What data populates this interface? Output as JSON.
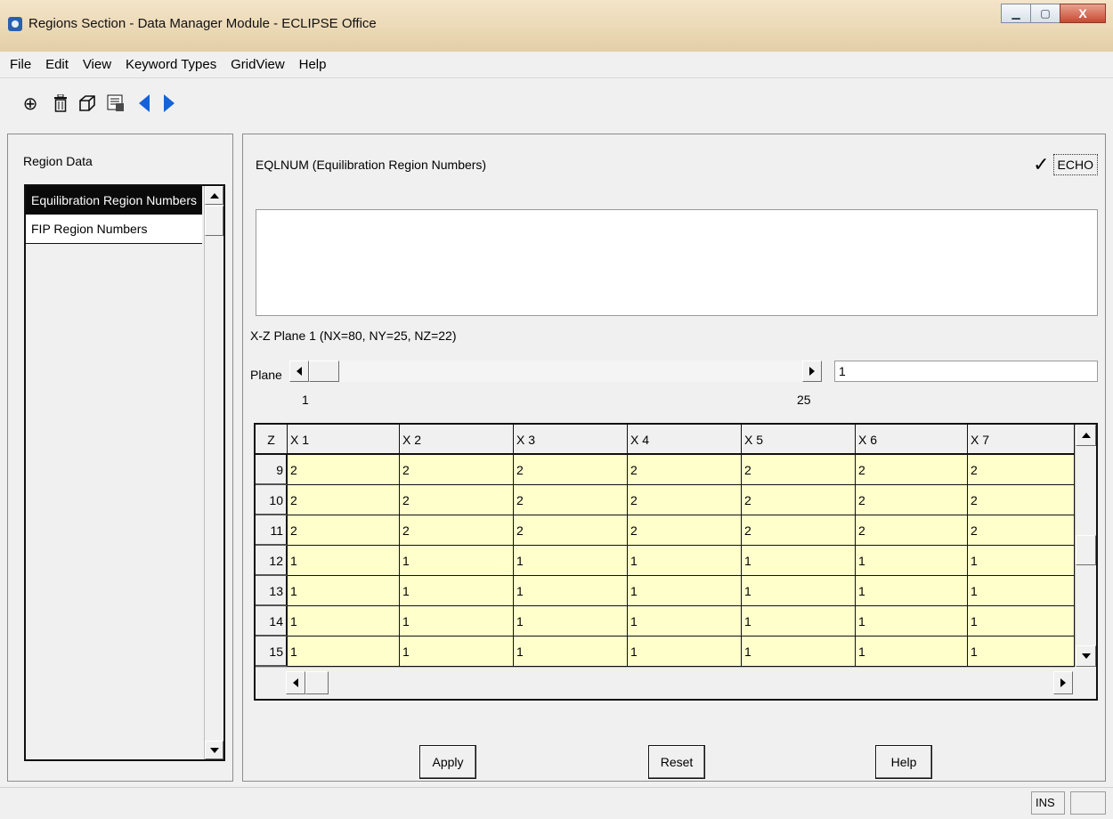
{
  "window": {
    "title": "Regions Section - Data Manager Module - ECLIPSE Office"
  },
  "menu": {
    "items": [
      "File",
      "Edit",
      "View",
      "Keyword Types",
      "GridView",
      "Help"
    ]
  },
  "toolbar": {
    "icons": [
      "crosshair-icon",
      "trash-icon",
      "cube-icon",
      "report-icon",
      "back-arrow-icon",
      "forward-arrow-icon"
    ],
    "glyphs": [
      "⊕",
      "🗑",
      "⬡",
      "▤"
    ]
  },
  "left_panel": {
    "title": "Region Data",
    "items": [
      "Equilibration Region Numbers",
      "FIP Region Numbers"
    ],
    "selected_index": 0
  },
  "main": {
    "keyword_title": "EQLNUM (Equilibration Region Numbers)",
    "echo_label": "ECHO",
    "echo_checked": true,
    "echo_check_glyph": "✓",
    "plane_info": "X-Z Plane 1 (NX=80, NY=25, NZ=22)",
    "plane_label": "Plane",
    "plane_value": "1",
    "plane_min": "1",
    "plane_max": "25"
  },
  "grid": {
    "z_header": "Z",
    "columns": [
      "X 1",
      "X 2",
      "X 3",
      "X 4",
      "X 5",
      "X 6",
      "X 7"
    ],
    "rows": [
      {
        "z": "9",
        "values": [
          "2",
          "2",
          "2",
          "2",
          "2",
          "2",
          "2"
        ]
      },
      {
        "z": "10",
        "values": [
          "2",
          "2",
          "2",
          "2",
          "2",
          "2",
          "2"
        ]
      },
      {
        "z": "11",
        "values": [
          "2",
          "2",
          "2",
          "2",
          "2",
          "2",
          "2"
        ]
      },
      {
        "z": "12",
        "values": [
          "1",
          "1",
          "1",
          "1",
          "1",
          "1",
          "1"
        ]
      },
      {
        "z": "13",
        "values": [
          "1",
          "1",
          "1",
          "1",
          "1",
          "1",
          "1"
        ]
      },
      {
        "z": "14",
        "values": [
          "1",
          "1",
          "1",
          "1",
          "1",
          "1",
          "1"
        ]
      },
      {
        "z": "15",
        "values": [
          "1",
          "1",
          "1",
          "1",
          "1",
          "1",
          "1"
        ]
      }
    ]
  },
  "buttons": {
    "apply": "Apply",
    "reset": "Reset",
    "help": "Help"
  },
  "status": {
    "ins": "INS"
  },
  "colors": {
    "cell_fill": "#ffffcc",
    "selection": "#0a0a0a",
    "nav_arrow": "#1563d8"
  }
}
